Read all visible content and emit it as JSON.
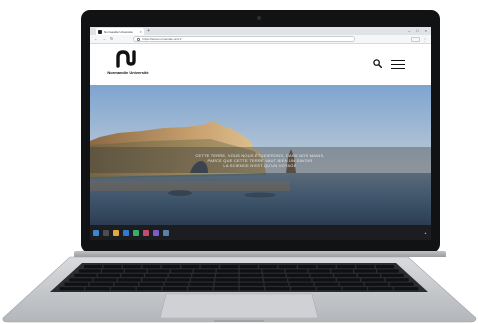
{
  "browser": {
    "tab_title": "Normandie Université",
    "tab_close": "×",
    "new_tab": "+",
    "address": "https://www.normandie-univ.fr",
    "window_controls": [
      "–",
      "□",
      "×"
    ],
    "nav": {
      "back": "←",
      "forward": "→",
      "reload": "↻"
    }
  },
  "site": {
    "name": "Normandie Université"
  },
  "hero": {
    "caption_lines": [
      "CETTE TERRE, VOUS NOUS ÉTUDIERONS, DANS NOS MAINS,",
      "PARCE QUE CETTE TERRE VAUT BIEN UN SAVOIR",
      "LA SCIENCE N'EST QU'UN VOYAGE"
    ]
  },
  "colors": {
    "bezel": "#111214",
    "sky_top": "#7ea4cf",
    "sky_bottom": "#c8d2da",
    "cliff": "#b08a5a",
    "sea": "#3f556b",
    "taskbar": "#1b1d21",
    "aluminum": "#c7c9cc"
  },
  "icons": {
    "search": "search-icon",
    "menu": "hamburger-icon",
    "logo": "normandie-logo-icon"
  }
}
